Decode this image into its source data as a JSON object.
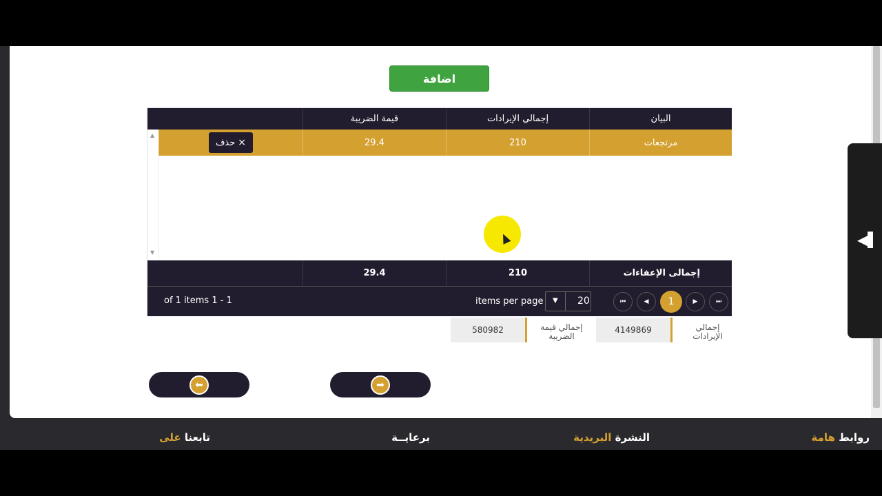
{
  "add_button": {
    "label": "اضافة"
  },
  "grid": {
    "columns": [
      "البيان",
      "إجمالي الإيرادات",
      "قيمة الضريبة"
    ],
    "rows": [
      {
        "description": "مرتجعات",
        "revenue": "210",
        "tax": "29.4",
        "delete_label": "حذف"
      }
    ],
    "footer": {
      "label": "إجمالى الإعفاءات",
      "revenue": "210",
      "tax": "29.4"
    },
    "pager": {
      "current_page": "1",
      "page_size": "20",
      "items_per_page_label": "items per page",
      "info": "of 1 items 1 - 1"
    }
  },
  "totals": {
    "revenue_label": "إجمالي الإيرادات",
    "revenue_value": "4149869",
    "tax_label": "إجمالي قيمة الضريبة",
    "tax_value": "580982"
  },
  "footer_nav": {
    "links_1": "روابط",
    "links_2": "هامة",
    "newsletter_1": "النشرة",
    "newsletter_2": "البريدية",
    "sponsor": "برعايــة",
    "follow_1": "تابعنا",
    "follow_2": "على"
  },
  "colors": {
    "accent": "#d4a030",
    "dark": "#221d2e",
    "green": "#3fa33f"
  }
}
